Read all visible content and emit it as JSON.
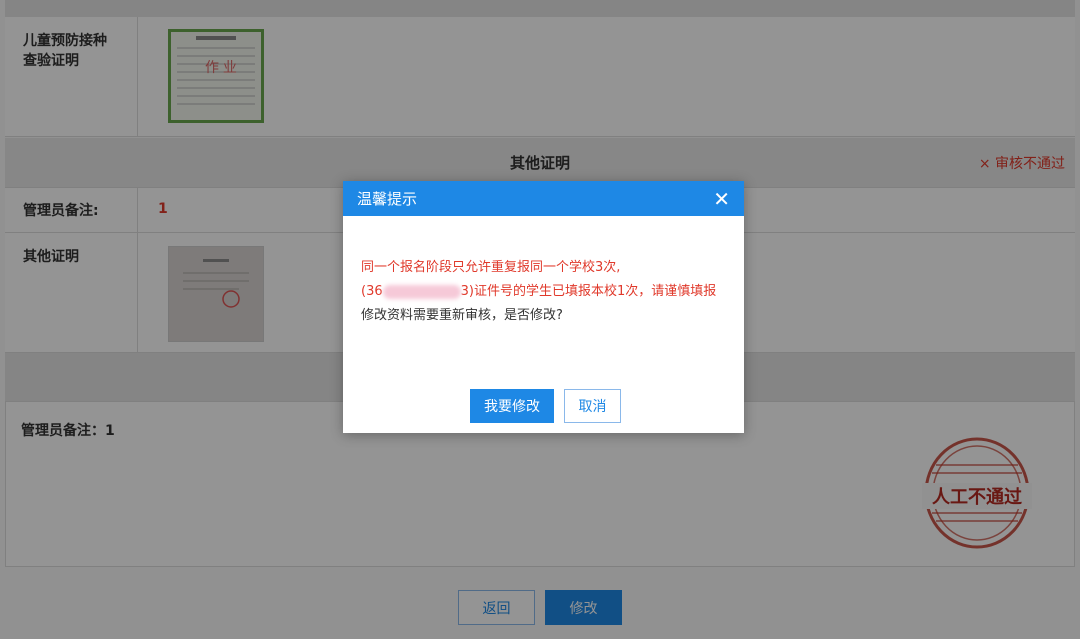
{
  "rows": {
    "vaccine": {
      "label": "儿童预防接种查验证明"
    },
    "other_section": {
      "title": "其他证明",
      "status": "× 审核不通过"
    },
    "admin_note": {
      "label": "管理员备注:",
      "value": "1"
    },
    "other_proof": {
      "label": "其他证明"
    }
  },
  "bottom_note": {
    "label": "管理员备注：1"
  },
  "stamp": {
    "text": "人工不通过"
  },
  "footer": {
    "back_label": "返回",
    "edit_label": "修改"
  },
  "dialog": {
    "title": "温馨提示",
    "warning_line1": "同一个报名阶段只允许重复报同一个学校3次,",
    "warning_prefix": "(36",
    "warning_suffix": "3)证件号的学生已填报本校1次，请谨慎填报",
    "question": "修改资料需要重新审核，是否修改?",
    "confirm_label": "我要修改",
    "cancel_label": "取消"
  },
  "colors": {
    "primary": "#1e88e5",
    "danger": "#e0392b"
  }
}
